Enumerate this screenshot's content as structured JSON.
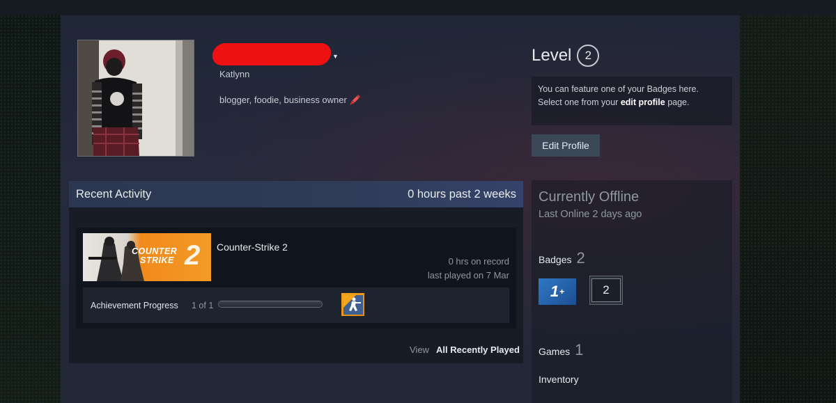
{
  "profile": {
    "real_name": "Katlynn",
    "summary": "blogger, foodie, business owner 🖍️",
    "level_label": "Level",
    "level_value": "2",
    "badge_feature_line1": "You can feature one of your Badges here.",
    "badge_feature_line2_prefix": "Select one from your ",
    "badge_feature_link": "edit profile",
    "badge_feature_line2_suffix": " page.",
    "edit_profile_label": "Edit Profile"
  },
  "status": {
    "state": "Currently Offline",
    "last_online": "Last Online 2 days ago",
    "badges_label": "Badges",
    "badges_count": "2",
    "badge_1_text": "1",
    "badge_1_sup": "+",
    "badge_2_text": "2",
    "games_label": "Games",
    "games_count": "1",
    "inventory_label": "Inventory"
  },
  "activity": {
    "title": "Recent Activity",
    "hours_summary": "0 hours past 2 weeks",
    "games": [
      {
        "name": "Counter-Strike 2",
        "capsule_line1": "COUNTER",
        "capsule_line2": "STRIKE",
        "capsule_number": "2",
        "hours_on_record": "0 hrs on record",
        "last_played": "last played on 7 Mar",
        "achievement_label": "Achievement Progress",
        "achievement_count": "1 of 1",
        "achievement_progress": 1.0
      }
    ],
    "view_label": "View",
    "view_link": "All Recently Played"
  },
  "colors": {
    "accent_blue": "#2f78c4",
    "game_orange": "#f39a25",
    "redaction": "#ee1111"
  },
  "icons": {
    "dropdown": "caret-down-icon",
    "achievement": "counter-strike-achievement-icon"
  }
}
